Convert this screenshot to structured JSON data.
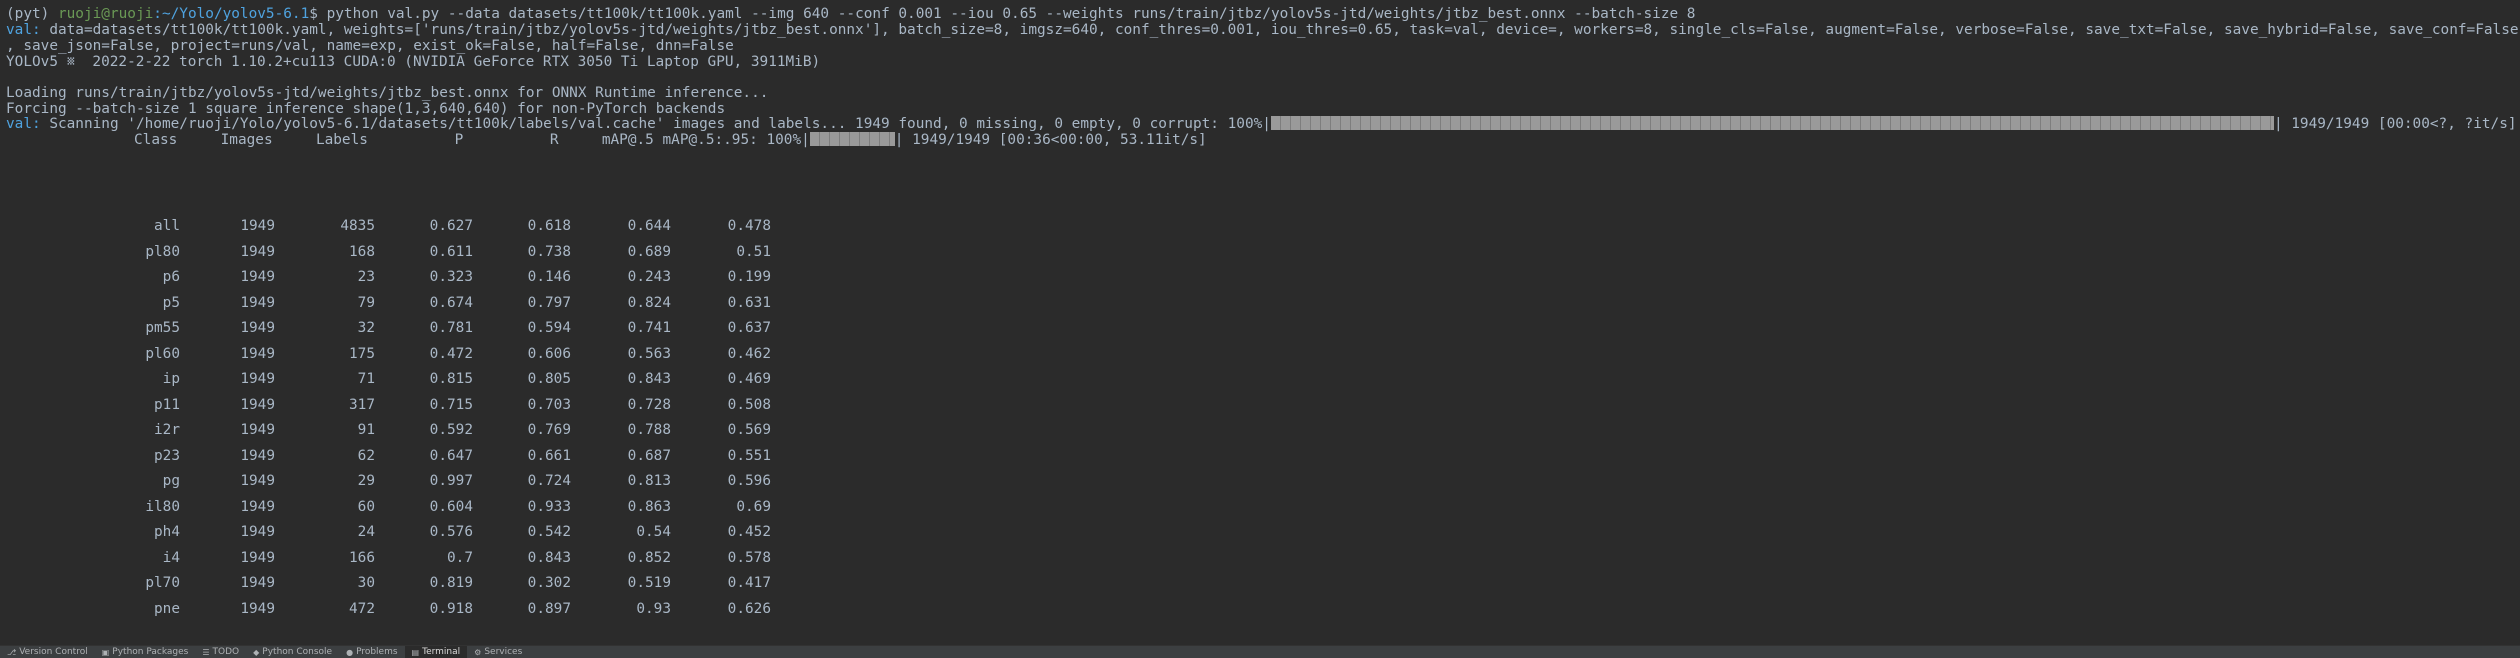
{
  "lines": {
    "prompt_env": "(pyt) ",
    "prompt_user": "ruoji@ruoji",
    "prompt_path": ":~/Yolo/yolov5-6.1",
    "prompt_cmd": "$ python val.py --data datasets/tt100k/tt100k.yaml --img 640 --conf 0.001 --iou 0.65 --weights runs/train/jtbz/yolov5s-jtd/weights/jtbz_best.onnx --batch-size 8",
    "val_prefix": "val:",
    "val_args_1": " data=datasets/tt100k/tt100k.yaml, weights=['runs/train/jtbz/yolov5s-jtd/weights/jtbz_best.onnx'], batch_size=8, imgsz=640, conf_thres=0.001, iou_thres=0.65, task=val, device=, workers=8, single_cls=False, augment=False, verbose=False, save_txt=False, save_hybrid=False, save_conf=False",
    "val_args_2": ", save_json=False, project=runs/val, name=exp, exist_ok=False, half=False, dnn=False",
    "env_info": "YOLOv5 ␧  2022-2-22 torch 1.10.2+cu113 CUDA:0 (NVIDIA GeForce RTX 3050 Ti Laptop GPU, 3911MiB)",
    "loading": "Loading runs/train/jtbz/yolov5s-jtd/weights/jtbz_best.onnx for ONNX Runtime inference...",
    "forcing": "Forcing --batch-size 1 square inference shape(1,3,640,640) for non-PyTorch backends",
    "scan_prefix": "val:",
    "scan_text": " Scanning '/home/ruoji/Yolo/yolov5-6.1/datasets/tt100k/labels/val.cache' images and labels... 1949 found, 0 missing, 0 empty, 0 corrupt: 100%|",
    "scan_tail": "| 1949/1949 [00:00<?, ?it/s]",
    "scan_progress": 1.0,
    "map_text": "Class     Images     Labels          P          R     mAP@.5 mAP@.5:.95: 100%|",
    "map_tail": "| 1949/1949 [00:36<00:00, 53.11it/s]",
    "map_progress": 1.0
  },
  "table": {
    "headers": [
      "Class",
      "Images",
      "Labels",
      "P",
      "R",
      "mAP@.5",
      "mAP@.5:.95:"
    ],
    "rows": [
      [
        "all",
        "1949",
        "4835",
        "0.627",
        "0.618",
        "0.644",
        "0.478"
      ],
      [
        "pl80",
        "1949",
        "168",
        "0.611",
        "0.738",
        "0.689",
        "0.51"
      ],
      [
        "p6",
        "1949",
        "23",
        "0.323",
        "0.146",
        "0.243",
        "0.199"
      ],
      [
        "p5",
        "1949",
        "79",
        "0.674",
        "0.797",
        "0.824",
        "0.631"
      ],
      [
        "pm55",
        "1949",
        "32",
        "0.781",
        "0.594",
        "0.741",
        "0.637"
      ],
      [
        "pl60",
        "1949",
        "175",
        "0.472",
        "0.606",
        "0.563",
        "0.462"
      ],
      [
        "ip",
        "1949",
        "71",
        "0.815",
        "0.805",
        "0.843",
        "0.469"
      ],
      [
        "p11",
        "1949",
        "317",
        "0.715",
        "0.703",
        "0.728",
        "0.508"
      ],
      [
        "i2r",
        "1949",
        "91",
        "0.592",
        "0.769",
        "0.788",
        "0.569"
      ],
      [
        "p23",
        "1949",
        "62",
        "0.647",
        "0.661",
        "0.687",
        "0.551"
      ],
      [
        "pg",
        "1949",
        "29",
        "0.997",
        "0.724",
        "0.813",
        "0.596"
      ],
      [
        "il80",
        "1949",
        "60",
        "0.604",
        "0.933",
        "0.863",
        "0.69"
      ],
      [
        "ph4",
        "1949",
        "24",
        "0.576",
        "0.542",
        "0.54",
        "0.452"
      ],
      [
        "i4",
        "1949",
        "166",
        "0.7",
        "0.843",
        "0.852",
        "0.578"
      ],
      [
        "pl70",
        "1949",
        "30",
        "0.819",
        "0.302",
        "0.519",
        "0.417"
      ],
      [
        "pne",
        "1949",
        "472",
        "0.918",
        "0.897",
        "0.93",
        "0.626"
      ]
    ]
  },
  "statusbar": {
    "tabs": [
      {
        "icon": "version-control-icon",
        "glyph": "⎇",
        "label": "Version Control",
        "active": false
      },
      {
        "icon": "python-packages-icon",
        "glyph": "▣",
        "label": "Python Packages",
        "active": false
      },
      {
        "icon": "todo-icon",
        "glyph": "☰",
        "label": "TODO",
        "active": false
      },
      {
        "icon": "python-console-icon",
        "glyph": "◆",
        "label": "Python Console",
        "active": false
      },
      {
        "icon": "problems-icon",
        "glyph": "●",
        "label": "Problems",
        "active": false
      },
      {
        "icon": "terminal-icon",
        "glyph": "▤",
        "label": "Terminal",
        "active": true
      },
      {
        "icon": "services-icon",
        "glyph": "⚙",
        "label": "Services",
        "active": false
      }
    ]
  },
  "colors": {
    "background": "#2b2b2b",
    "text": "#a9b7c6",
    "prompt_user": "#6a9955",
    "prompt_path": "#4fa3e0",
    "statusbar": "#3c3f41"
  }
}
